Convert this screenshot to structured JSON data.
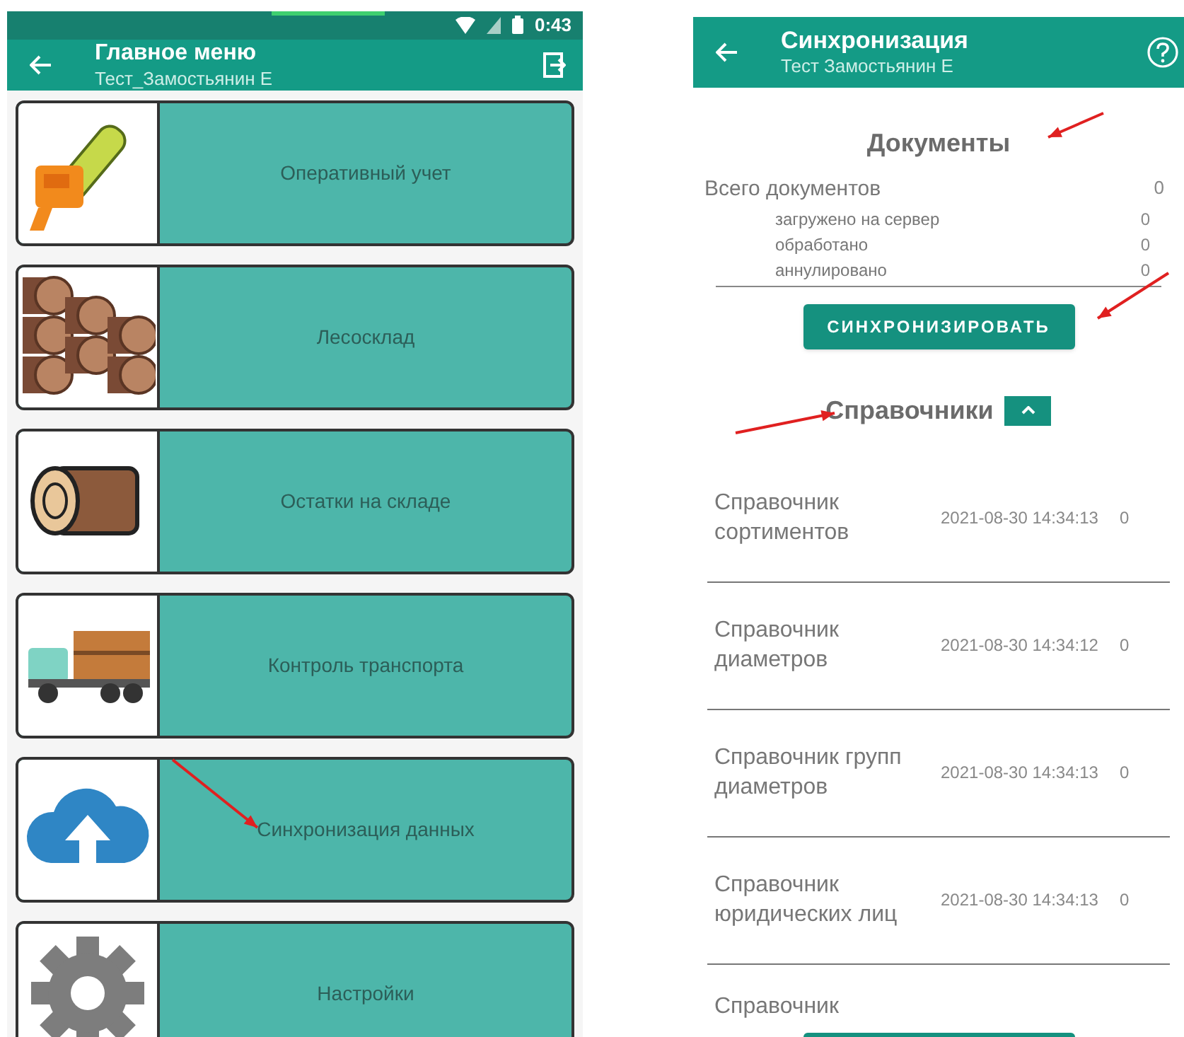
{
  "left_screen": {
    "status_bar": {
      "time": "0:43"
    },
    "header": {
      "title": "Главное меню",
      "subtitle": "Тест_Замостьянин Е"
    },
    "menu_items": [
      {
        "label": "Оперативный учет",
        "kind": "chainsaw"
      },
      {
        "label": "Лесосклад",
        "kind": "logs"
      },
      {
        "label": "Остатки на складе",
        "kind": "log"
      },
      {
        "label": "Контроль транспорта",
        "kind": "truck"
      },
      {
        "label": "Синхронизация данных",
        "kind": "cloud"
      },
      {
        "label": "Настройки",
        "kind": "gear"
      }
    ]
  },
  "right_screen": {
    "header": {
      "title": "Синхронизация",
      "subtitle": "Тест Замостьянин Е"
    },
    "documents": {
      "title": "Документы",
      "total": {
        "label": "Всего документов",
        "value": "0"
      },
      "details": [
        {
          "label": "загружено на сервер",
          "value": "0"
        },
        {
          "label": "обработано",
          "value": "0"
        },
        {
          "label": "аннулировано",
          "value": "0"
        }
      ]
    },
    "sync_button": "СИНХРОНИЗИРОВАТЬ",
    "references": {
      "title": "Справочники",
      "expanded": true,
      "items": [
        {
          "name": "Справочник сортиментов",
          "date": "2021-08-30 14:34:13",
          "count": "0"
        },
        {
          "name": "Справочник диаметров",
          "date": "2021-08-30 14:34:12",
          "count": "0"
        },
        {
          "name": "Справочник групп диаметров",
          "date": "2021-08-30 14:34:13",
          "count": "0"
        },
        {
          "name": "Справочник юридических лиц",
          "date": "2021-08-30 14:34:13",
          "count": "0"
        },
        {
          "name": "Справочник"
        }
      ]
    }
  }
}
